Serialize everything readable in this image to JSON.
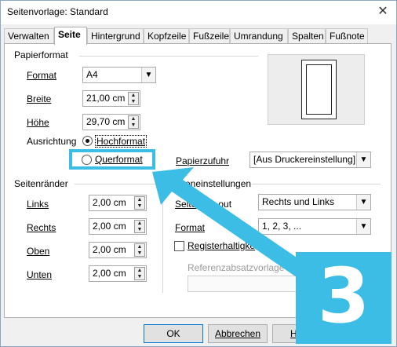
{
  "window": {
    "title": "Seitenvorlage: Standard",
    "close_glyph": "✕"
  },
  "tabs": [
    {
      "label": "Verwalten"
    },
    {
      "label": "Seite"
    },
    {
      "label": "Hintergrund"
    },
    {
      "label": "Kopfzeile"
    },
    {
      "label": "Fußzeile"
    },
    {
      "label": "Umrandung"
    },
    {
      "label": "Spalten"
    },
    {
      "label": "Fußnote"
    }
  ],
  "active_tab": "Seite",
  "papierformat": {
    "heading": "Papierformat",
    "format_label": "Format",
    "format_value": "A4",
    "breite_label": "Breite",
    "breite_value": "21,00 cm",
    "hoehe_label": "Höhe",
    "hoehe_value": "29,70 cm",
    "ausrichtung_label": "Ausrichtung",
    "hochformat_label": "Hochformat",
    "querformat_label": "Querformat",
    "selected_orientation": "Hochformat",
    "papierzufuhr_label": "Papierzufuhr",
    "papierzufuhr_value": "[Aus Druckereinstellung]"
  },
  "seitenraender": {
    "heading": "Seitenränder",
    "links_label": "Links",
    "links_value": "2,00 cm",
    "rechts_label": "Rechts",
    "rechts_value": "2,00 cm",
    "oben_label": "Oben",
    "oben_value": "2,00 cm",
    "unten_label": "Unten",
    "unten_value": "2,00 cm"
  },
  "layout": {
    "heading_visible": "iteneinstellungen",
    "seitenlayout_label_visible": "Seite",
    "seitenlayout_label_tail": "out",
    "seitenlayout_value": "Rechts und Links",
    "format_label": "Format",
    "format_value": "1, 2, 3, ...",
    "registerhaltigkeit_label": "Registerhaltigke",
    "referenz_label": "Referenzabsatzvorlage"
  },
  "footer": {
    "ok_label": "OK",
    "abbrechen_label": "Abbrechen",
    "hilfe_label": "Hilfe",
    "zurueck_label_tail": "ck"
  },
  "annotation": {
    "step_number": "3",
    "color": "#3bbde6"
  }
}
